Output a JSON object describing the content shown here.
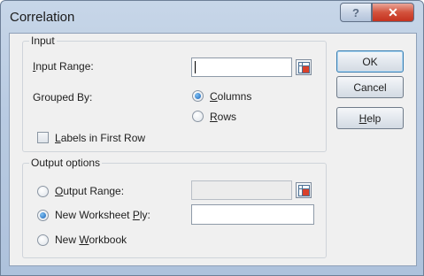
{
  "window": {
    "title": "Correlation"
  },
  "titlebar": {
    "help_glyph": "?",
    "close_glyph": "✕"
  },
  "input_group": {
    "legend": "Input",
    "input_range_label": "Input Range:",
    "input_range_value": "",
    "grouped_by_label": "Grouped By:",
    "columns_label": "Columns",
    "columns_selected": true,
    "rows_label": "Rows",
    "rows_selected": false,
    "labels_first_row_label": "Labels in First Row",
    "labels_first_row_checked": false
  },
  "output_group": {
    "legend": "Output options",
    "output_range_label": "Output Range:",
    "output_range_selected": false,
    "output_range_value": "",
    "new_worksheet_label": "New Worksheet Ply:",
    "new_worksheet_selected": true,
    "new_worksheet_value": "",
    "new_workbook_label": "New Workbook",
    "new_workbook_selected": false
  },
  "buttons": {
    "ok": "OK",
    "cancel": "Cancel",
    "help": "Help"
  },
  "icons": {
    "range_selector": "range-selector-icon",
    "help": "help-icon",
    "close": "close-icon"
  }
}
